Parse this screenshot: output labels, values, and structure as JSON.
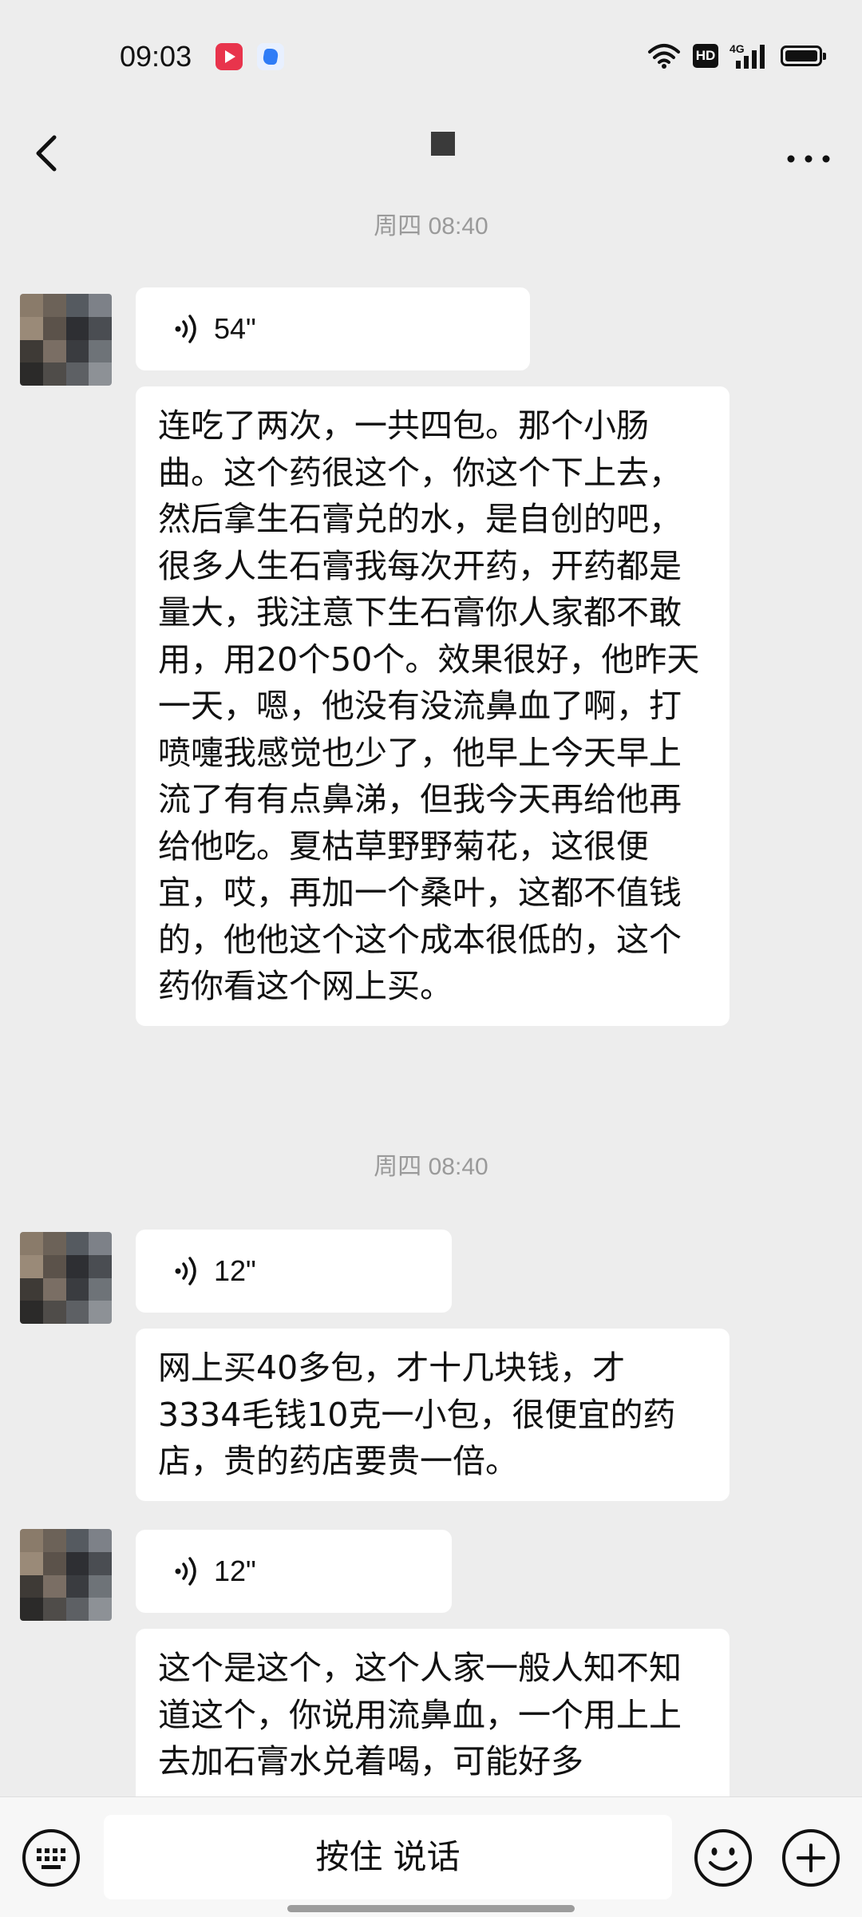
{
  "status_bar": {
    "time": "09:03",
    "network": "4G",
    "hd_label": "HD"
  },
  "header": {
    "back_icon": "chevron-left-icon",
    "more_icon": "more-dots-icon"
  },
  "messages": [
    {
      "timestamp": "周四 08:40",
      "voice_duration": "54\"",
      "transcript": "连吃了两次，一共四包。那个小肠曲。这个药很这个，你这个下上去，然后拿生石膏兑的水，是自创的吧，很多人生石膏我每次开药，开药都是量大，我注意下生石膏你人家都不敢用，用20个50个。效果很好，他昨天一天，嗯，他没有没流鼻血了啊，打喷嚏我感觉也少了，他早上今天早上流了有有点鼻涕，但我今天再给他再给他吃。夏枯草野野菊花，这很便宜，哎，再加一个桑叶，这都不值钱的，他他这个这个成本很低的，这个药你看这个网上买。"
    },
    {
      "timestamp": "周四 08:40",
      "voice_duration": "12\"",
      "transcript": "网上买40多包，才十几块钱，才3334毛钱10克一小包，很便宜的药店，贵的药店要贵一倍。"
    },
    {
      "voice_duration": "12\"",
      "transcript": "这个是这个，这个人家一般人知不知道这个，你说用流鼻血，一个用上上去加石膏水兑着喝，可能好多"
    }
  ],
  "input_bar": {
    "hold_to_talk": "按住 说话",
    "keyboard_icon": "keyboard-icon",
    "emoji_icon": "emoji-icon",
    "plus_icon": "plus-icon"
  },
  "colors": {
    "background": "#ededed",
    "bubble": "#ffffff",
    "timestamp": "#9a9a9a"
  }
}
